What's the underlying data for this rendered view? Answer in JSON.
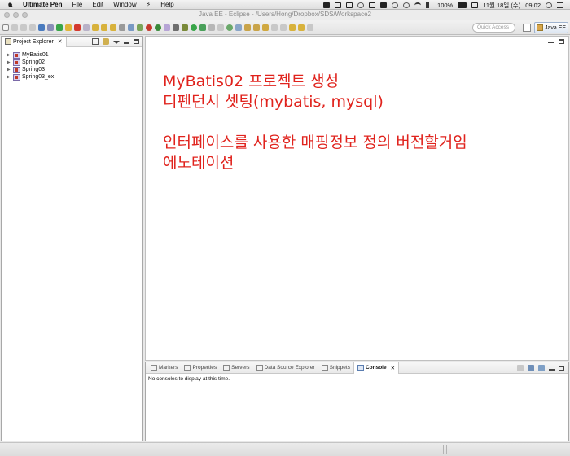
{
  "menubar": {
    "app_name": "Ultimate Pen",
    "items": [
      "File",
      "Edit",
      "Window",
      "Help"
    ],
    "battery": "100%",
    "date": "11월 18일 (수)",
    "time": "09:02"
  },
  "window": {
    "title": "Java EE - Eclipse - /Users/Hong/Dropbox/SDS/Workspace2"
  },
  "toolbar": {
    "quick_access_placeholder": "Quick Access",
    "perspective": "Java EE"
  },
  "explorer": {
    "title": "Project Explorer",
    "projects": [
      {
        "name": "MyBatis01",
        "icon": "maven-project-icon"
      },
      {
        "name": "Spring02",
        "icon": "spring-project-icon"
      },
      {
        "name": "Spring03",
        "icon": "spring-project-icon"
      },
      {
        "name": "Spring03_ex",
        "icon": "spring-project-icon"
      }
    ]
  },
  "notes": {
    "color": "#e0231d",
    "lines": [
      "MyBatis02 프로젝트 생성",
      "디펜던시 셋팅(mybatis, mysql)",
      "인터페이스를 사용한 매핑정보 정의  버전할거임",
      "에노테이션"
    ]
  },
  "bottom_panel": {
    "tabs": [
      "Markers",
      "Properties",
      "Servers",
      "Data Source Explorer",
      "Snippets",
      "Console"
    ],
    "active_tab": "Console",
    "message": "No consoles to display at this time."
  }
}
